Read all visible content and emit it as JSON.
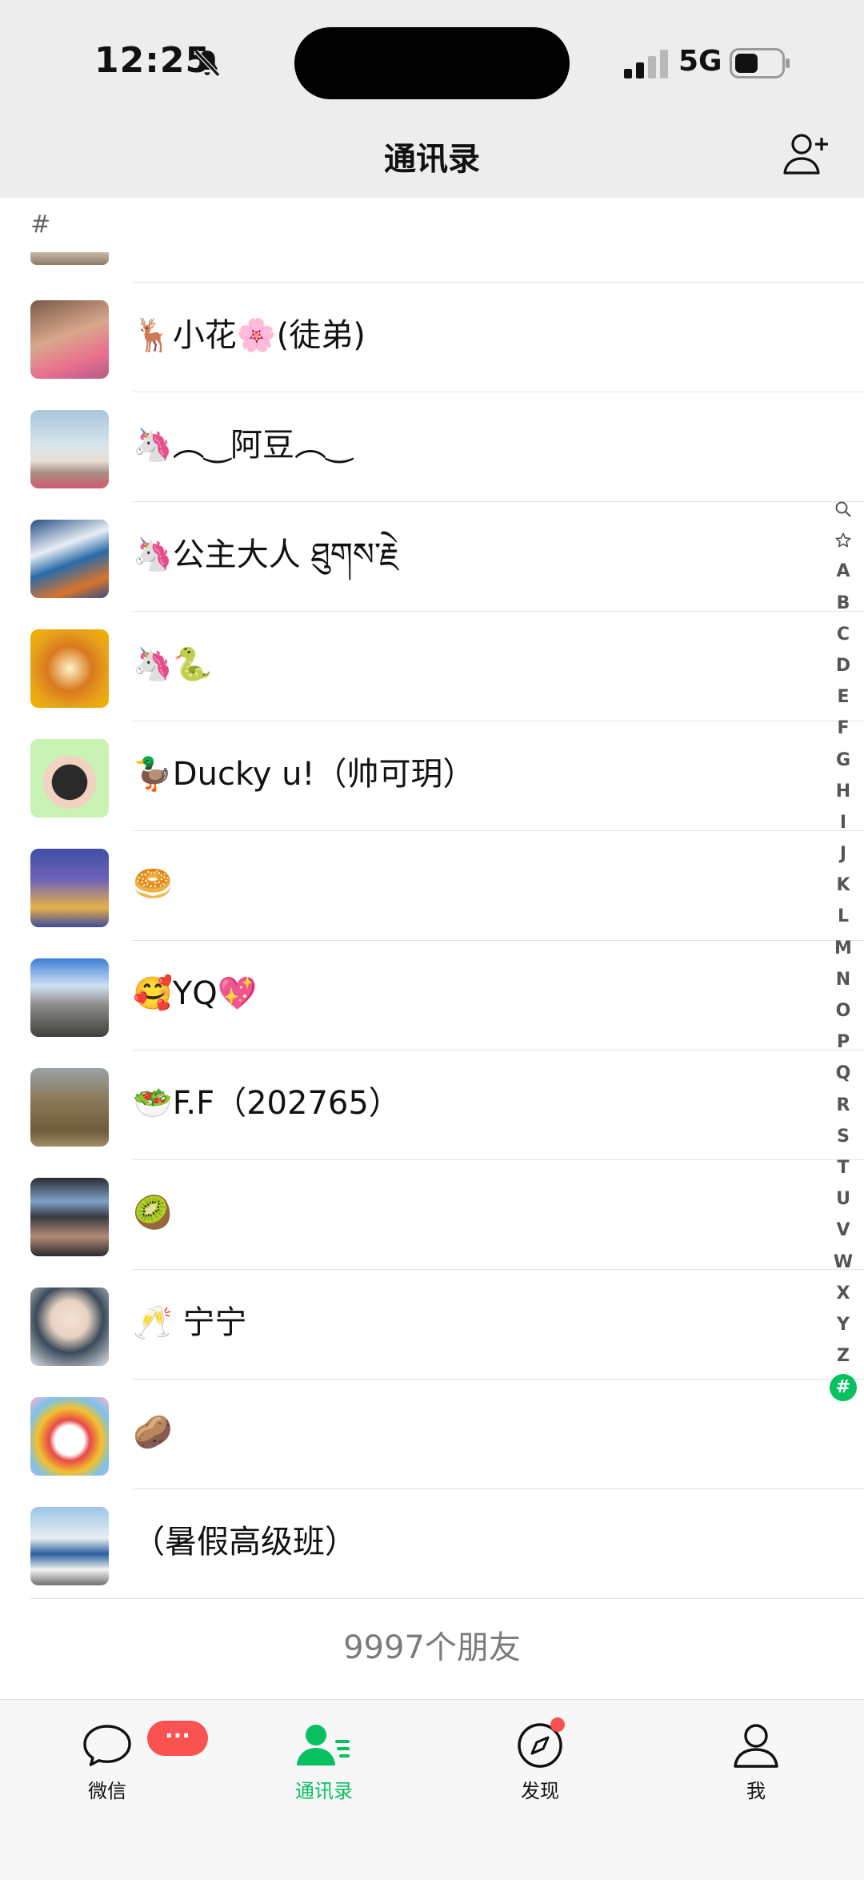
{
  "status": {
    "time": "12:25",
    "network": "5G"
  },
  "header": {
    "title": "通讯录"
  },
  "list": {
    "section": "#",
    "contacts": [
      {
        "name": "🦌小花🌸(徒弟)"
      },
      {
        "name": "🦄︵‿阿豆︵‿"
      },
      {
        "name": "🦄公主大人 ཐུགས་རྗེ"
      },
      {
        "name": "🦄🐍"
      },
      {
        "name": "🦆Ducky u!（帅可玥）"
      },
      {
        "name": "🥯"
      },
      {
        "name": "🥰YQ💖"
      },
      {
        "name": "🥗F.F（202765）"
      },
      {
        "name": "🥝"
      },
      {
        "name": "🥂 宁宁"
      },
      {
        "name": "🥔"
      },
      {
        "name": "（暑假高级班）"
      }
    ],
    "friend_count": "9997个朋友"
  },
  "index": [
    "A",
    "B",
    "C",
    "D",
    "E",
    "F",
    "G",
    "H",
    "I",
    "J",
    "K",
    "L",
    "M",
    "N",
    "O",
    "P",
    "Q",
    "R",
    "S",
    "T",
    "U",
    "V",
    "W",
    "X",
    "Y",
    "Z",
    "#"
  ],
  "tabbar": {
    "wechat": {
      "label": "微信",
      "badge": "···"
    },
    "contacts": {
      "label": "通讯录"
    },
    "discover": {
      "label": "发现"
    },
    "me": {
      "label": "我"
    }
  },
  "colors": {
    "accent": "#07c160",
    "badge": "#fa5151",
    "header_bg": "#ededed"
  }
}
